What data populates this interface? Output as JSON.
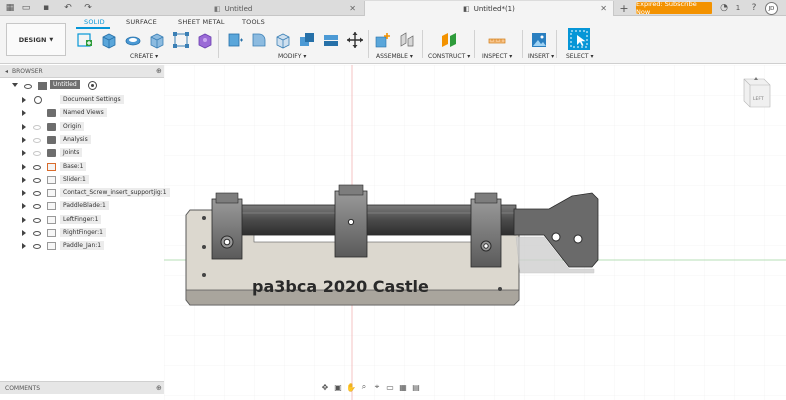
{
  "titlebar": {
    "tabs": [
      {
        "label": "Untitled",
        "active": false
      },
      {
        "label": "Untitled*(1)",
        "active": true
      }
    ],
    "new_tab": "+",
    "subscribe_label": "Expired: Subscribe Now",
    "notification_count": "1",
    "user_initials": "JD"
  },
  "toolbar": {
    "design_label": "DESIGN",
    "workspace_tabs": [
      "SOLID",
      "SURFACE",
      "SHEET METAL",
      "TOOLS"
    ],
    "groups": [
      "CREATE",
      "MODIFY",
      "ASSEMBLE",
      "CONSTRUCT",
      "INSPECT",
      "INSERT",
      "SELECT"
    ]
  },
  "browser": {
    "header": "BROWSER",
    "root": "Untitled",
    "items": [
      {
        "label": "Document Settings",
        "icon": "gear-icon"
      },
      {
        "label": "Named Views",
        "icon": "folder-icon"
      },
      {
        "label": "Origin",
        "icon": "folder-icon"
      },
      {
        "label": "Analysis",
        "icon": "folder-icon"
      },
      {
        "label": "Joints",
        "icon": "folder-icon"
      },
      {
        "label": "Base:1",
        "icon": "component-icon"
      },
      {
        "label": "Slider:1",
        "icon": "component-icon"
      },
      {
        "label": "Contact_Screw_insert_supportjig:1",
        "icon": "component-icon"
      },
      {
        "label": "PaddleBlade:1",
        "icon": "component-icon"
      },
      {
        "label": "LeftFinger:1",
        "icon": "component-icon"
      },
      {
        "label": "RightFinger:1",
        "icon": "component-icon"
      },
      {
        "label": "Paddle_Jan:1",
        "icon": "component-icon"
      }
    ]
  },
  "comments": {
    "header": "COMMENTS"
  },
  "viewcube": {
    "face_label": "LEFT"
  },
  "model": {
    "engraved_text": "pa3bca 2020 Castle"
  },
  "colors": {
    "accent": "#0696d7",
    "subscribe": "#f39200"
  }
}
